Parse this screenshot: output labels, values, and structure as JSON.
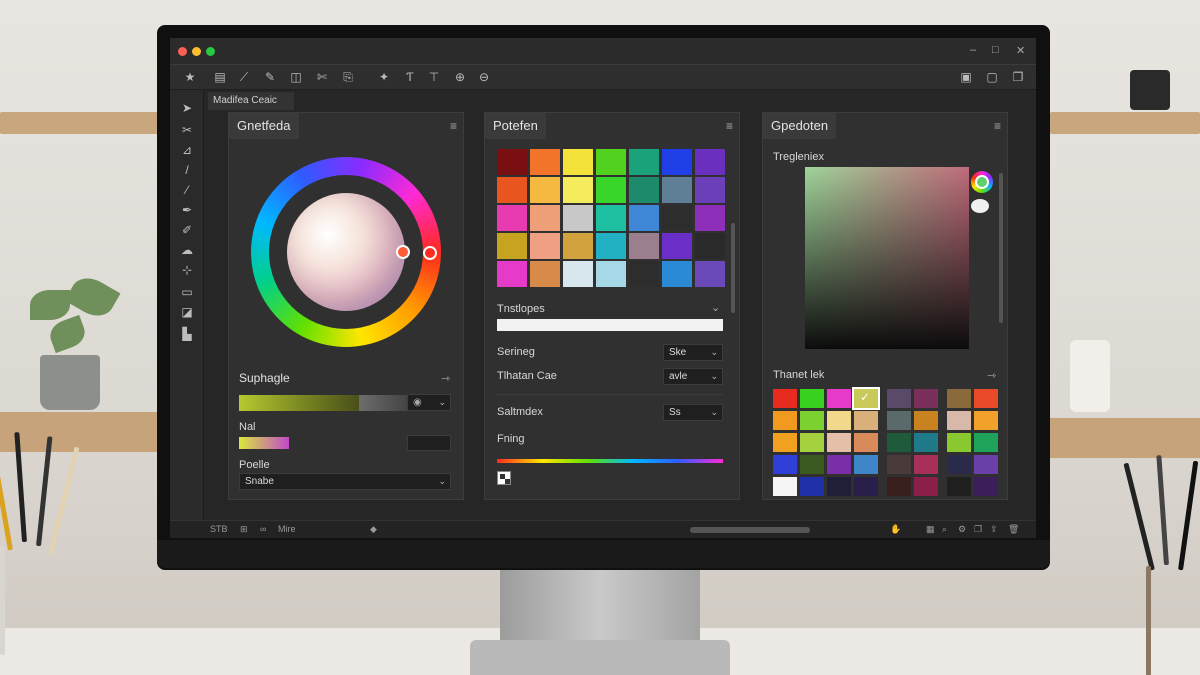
{
  "window": {
    "colors": {
      "close": "#ff5f57",
      "minimize": "#febc2e",
      "zoom": "#28c840"
    },
    "controls": [
      "–",
      "□",
      "✕"
    ]
  },
  "toolbar": {
    "icons": [
      "star-icon",
      "layers-icon",
      "brush-icon",
      "pen-icon",
      "frame-icon",
      "crop-icon",
      "export-icon",
      "wand-icon",
      "text-tool-icon",
      "stamp-icon",
      "zoom-in-icon",
      "zoom-out-icon"
    ],
    "right_icons": [
      "panel-left-icon",
      "panel-center-icon",
      "panel-right-icon"
    ]
  },
  "tools": [
    "move-tool-icon",
    "lasso-tool-icon",
    "select-tool-icon",
    "brush-tool-icon",
    "eyedropper-tool-icon",
    "pen-tool-icon",
    "dropper-tool-icon",
    "shape-tool-icon",
    "transform-tool-icon",
    "rect-tool-icon",
    "frame-tool-icon"
  ],
  "document_tab": "Madifea Ceaic",
  "panel1": {
    "title": "Gnetfeda",
    "section_label": "Suphagle",
    "nal_label": "Nal",
    "profile_label": "Poelle",
    "profile_value": "Snabe",
    "hue_accent": "#ff5a36"
  },
  "panel2": {
    "title": "Potefen",
    "swatches": [
      [
        "#7a0f12",
        "#f2742a",
        "#f2e23a",
        "#52d11f",
        "#1aa37a",
        "#1f3fe8",
        "#6b2fc0"
      ],
      [
        "#e8551f",
        "#f5b840",
        "#f4ec5c",
        "#3ad52a",
        "#1d8a6b",
        "#5f7f96",
        "#6a3fb8"
      ],
      [
        "#e83bb2",
        "#ef9f78",
        "#c8c8c8",
        "#1fbfa2",
        "#3f86d6",
        "#2d2d2d",
        "#8d2fb8"
      ],
      [
        "#c7a31f",
        "#f0a082",
        "#d2a23f",
        "#22b1c2",
        "#9c7f8f",
        "#6b2fc8",
        "#2a2a2a"
      ],
      [
        "#e63bc8",
        "#d78a4a",
        "#d8e6ee",
        "#a6d8e8",
        "#2d2d2d",
        "#2a8ad6",
        "#6a4ab8"
      ]
    ],
    "transform_label": "Tnstlopes",
    "setting1_label": "Serineg",
    "setting1_value": "Ske",
    "setting2_label": "Tlhatan Cae",
    "setting2_value": "avle",
    "setting3_label": "Saltmdex",
    "setting3_value": "Ss",
    "fill_label": "Fning"
  },
  "panel3": {
    "title": "Gpedoten",
    "picker_label": "Tregleniex",
    "palette_label": "Thanet lek",
    "palette_swatches": [
      [
        "#e82b1f",
        "#39d11f",
        "#e63bc8",
        "#c9c95a",
        "#5a4a6a",
        "#7a2f5a",
        "#8a6a3a",
        "#e84a2a"
      ],
      [
        "#f29a1f",
        "#7ad12f",
        "#f2d88a",
        "#d9b07a",
        "#5a6a6a",
        "#c8821f",
        "#d8b8a8",
        "#f2a22a"
      ],
      [
        "#f2a01f",
        "#a6d13f",
        "#e6bfa8",
        "#d88a5a",
        "#1f5a3a",
        "#1f7a8a",
        "#8ac82f",
        "#1fa25a"
      ],
      [
        "#2f3fd8",
        "#3a5a1f",
        "#7a2fa8",
        "#3f86c8",
        "#4a3a3a",
        "#a82f5a",
        "#2a2a4a",
        "#6a3fa8"
      ],
      [
        "#f5f5f5",
        "#1f2fa8",
        "#1f1f3a",
        "#2a1f4a",
        "#3a1f1f",
        "#8a1f4a",
        "#1f1f1f",
        "#3a1f5a"
      ]
    ]
  },
  "statusbar": {
    "left_text": "STB",
    "mid_text": "Mire"
  }
}
